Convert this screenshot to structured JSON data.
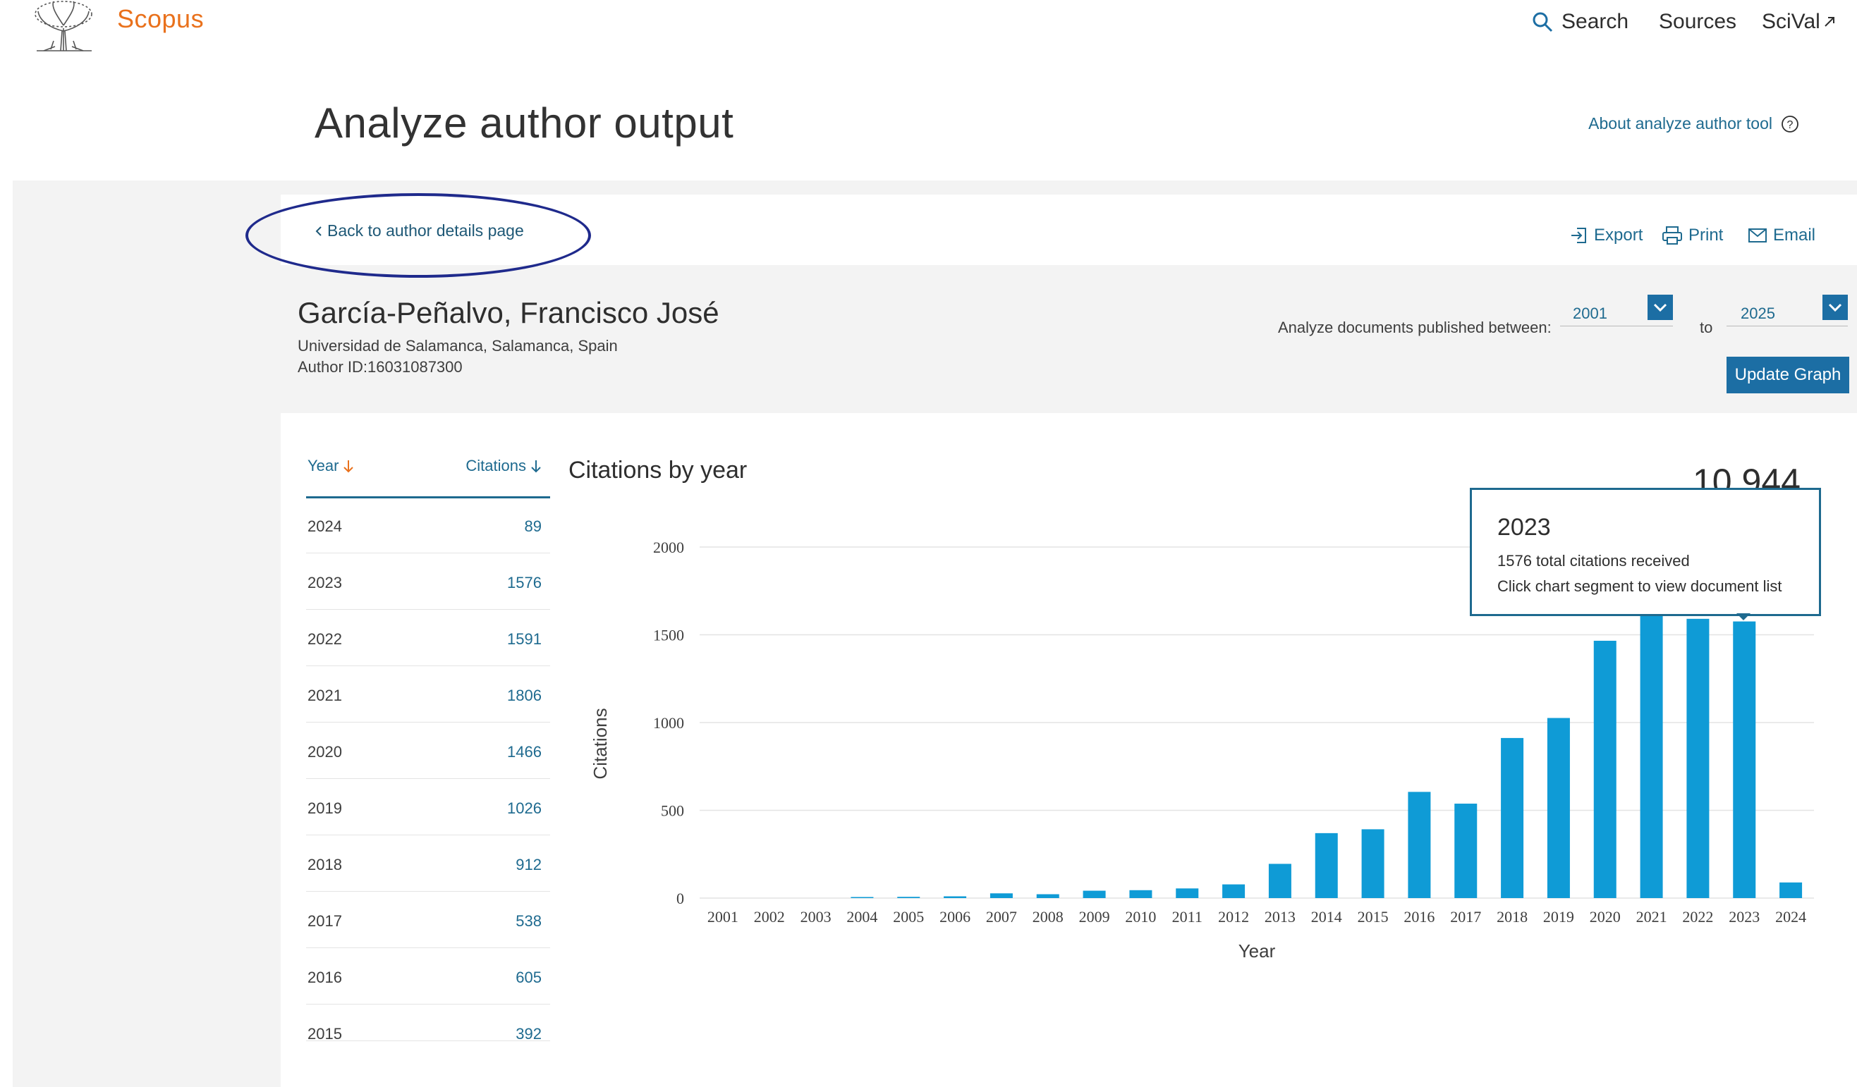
{
  "header": {
    "brand": "Scopus",
    "nav": [
      {
        "label": "Search",
        "icon": "search-icon"
      },
      {
        "label": "Sources"
      },
      {
        "label": "SciVal",
        "icon": "external-link-icon"
      }
    ]
  },
  "page": {
    "title": "Analyze author output",
    "about_link": "About analyze author tool",
    "back_link": "Back to author details page",
    "actions": [
      {
        "label": "Export",
        "icon": "export-icon"
      },
      {
        "label": "Print",
        "icon": "print-icon"
      },
      {
        "label": "Email",
        "icon": "email-icon"
      }
    ]
  },
  "author": {
    "name": "García-Peñalvo, Francisco José",
    "affiliation": "Universidad de Salamanca, Salamanca, Spain",
    "author_id": "Author ID:16031087300"
  },
  "range": {
    "label": "Analyze documents published between:",
    "from": "2001",
    "to_label": "to",
    "to": "2025",
    "update_button": "Update Graph"
  },
  "table": {
    "year_header": "Year",
    "citations_header": "Citations",
    "rows": [
      {
        "year": "2024",
        "citations": "89"
      },
      {
        "year": "2023",
        "citations": "1576"
      },
      {
        "year": "2022",
        "citations": "1591"
      },
      {
        "year": "2021",
        "citations": "1806"
      },
      {
        "year": "2020",
        "citations": "1466"
      },
      {
        "year": "2019",
        "citations": "1026"
      },
      {
        "year": "2018",
        "citations": "912"
      },
      {
        "year": "2017",
        "citations": "538"
      },
      {
        "year": "2016",
        "citations": "605"
      },
      {
        "year": "2015",
        "citations": "392"
      }
    ]
  },
  "chart": {
    "total": "10,944",
    "tooltip": {
      "year": "2023",
      "line1": "1576 total citations received",
      "line2": "Click chart segment to view document list"
    }
  },
  "colors": {
    "accent": "#1c6ea4",
    "link": "#1e6a8f",
    "bar": "#0f9bd6",
    "brand": "#e9711c",
    "annotation_ellipse": "#1f2a8c"
  },
  "chart_data": {
    "type": "bar",
    "title": "Citations by year",
    "xlabel": "Year",
    "ylabel": "Citations",
    "ylim": [
      0,
      2000
    ],
    "yticks": [
      0,
      500,
      1000,
      1500,
      2000
    ],
    "grid": true,
    "categories": [
      "2001",
      "2002",
      "2003",
      "2004",
      "2005",
      "2006",
      "2007",
      "2008",
      "2009",
      "2010",
      "2011",
      "2012",
      "2013",
      "2014",
      "2015",
      "2016",
      "2017",
      "2018",
      "2019",
      "2020",
      "2021",
      "2022",
      "2023",
      "2024"
    ],
    "values": [
      0,
      0,
      0,
      5,
      7,
      10,
      27,
      22,
      42,
      45,
      55,
      78,
      195,
      370,
      392,
      605,
      538,
      912,
      1026,
      1466,
      1806,
      1591,
      1576,
      89
    ]
  }
}
